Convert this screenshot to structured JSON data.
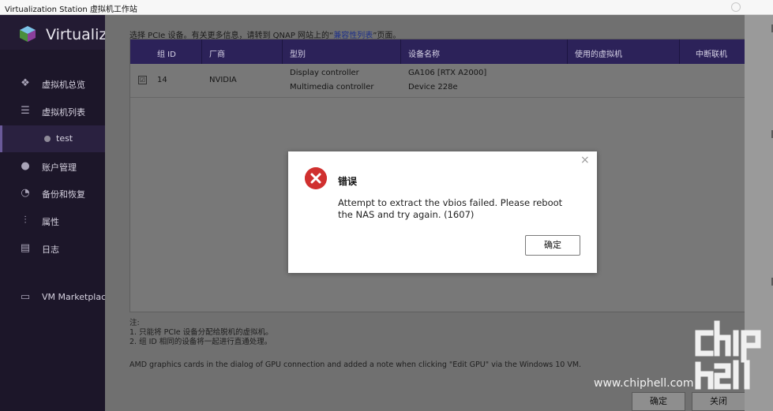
{
  "titlebar": {
    "title": "Virtualization Station 虚拟机工作站"
  },
  "sidebar": {
    "brand": "Virtualiz",
    "items": [
      {
        "icon": "overview-icon",
        "label": "虚拟机总览"
      },
      {
        "icon": "list-icon",
        "label": "虚拟机列表"
      },
      {
        "icon": "vm-status-dot-icon",
        "label": "test"
      },
      {
        "icon": "account-icon",
        "label": "账户管理"
      },
      {
        "icon": "backup-icon",
        "label": "备份和恢复"
      },
      {
        "icon": "properties-icon",
        "label": "属性"
      },
      {
        "icon": "log-icon",
        "label": "日志"
      },
      {
        "icon": "marketplace-icon",
        "label": "VM Marketplace"
      }
    ]
  },
  "main": {
    "info_prefix": "选择 PCIe 设备。有关更多信息，请转到 QNAP 网站上的“",
    "info_link": "兼容性列表",
    "info_suffix": "”页面。",
    "table": {
      "headers": [
        "组 ID",
        "厂商",
        "型别",
        "设备名称",
        "使用的虚拟机",
        "中断联机"
      ],
      "rows": [
        {
          "checked": "☑",
          "group_id": "14",
          "vendor": "NVIDIA",
          "type_1": "Display controller",
          "type_2": "Multimedia controller",
          "device_1": "GA106 [RTX A2000]",
          "device_2": "Device 228e",
          "vm": "",
          "disconnect": ""
        }
      ]
    },
    "notes_title": "注:",
    "note_1": "1. 只能将 PCIe 设备分配给脱机的虚拟机。",
    "note_2": "2. 组 ID 相同的设备将一起进行直通处理。",
    "amd_note": "AMD graphics cards in the dialog of GPU connection and added a note when clicking \"Edit GPU\" via the Windows 10 VM.",
    "ok_label": "确定",
    "close_label": "关闭"
  },
  "dialog": {
    "title": "错误",
    "message": "Attempt to extract the vbios failed. Please reboot the NAS and try again. (1607)",
    "ok_label": "确定",
    "close_glyph": "×"
  },
  "watermark": {
    "url": "www.chiphell.com",
    "logo_text": "chip hell"
  },
  "colors": {
    "error_red": "#d0302f",
    "header_bg": "#2c2259",
    "sidebar_bg": "#1c1629"
  }
}
